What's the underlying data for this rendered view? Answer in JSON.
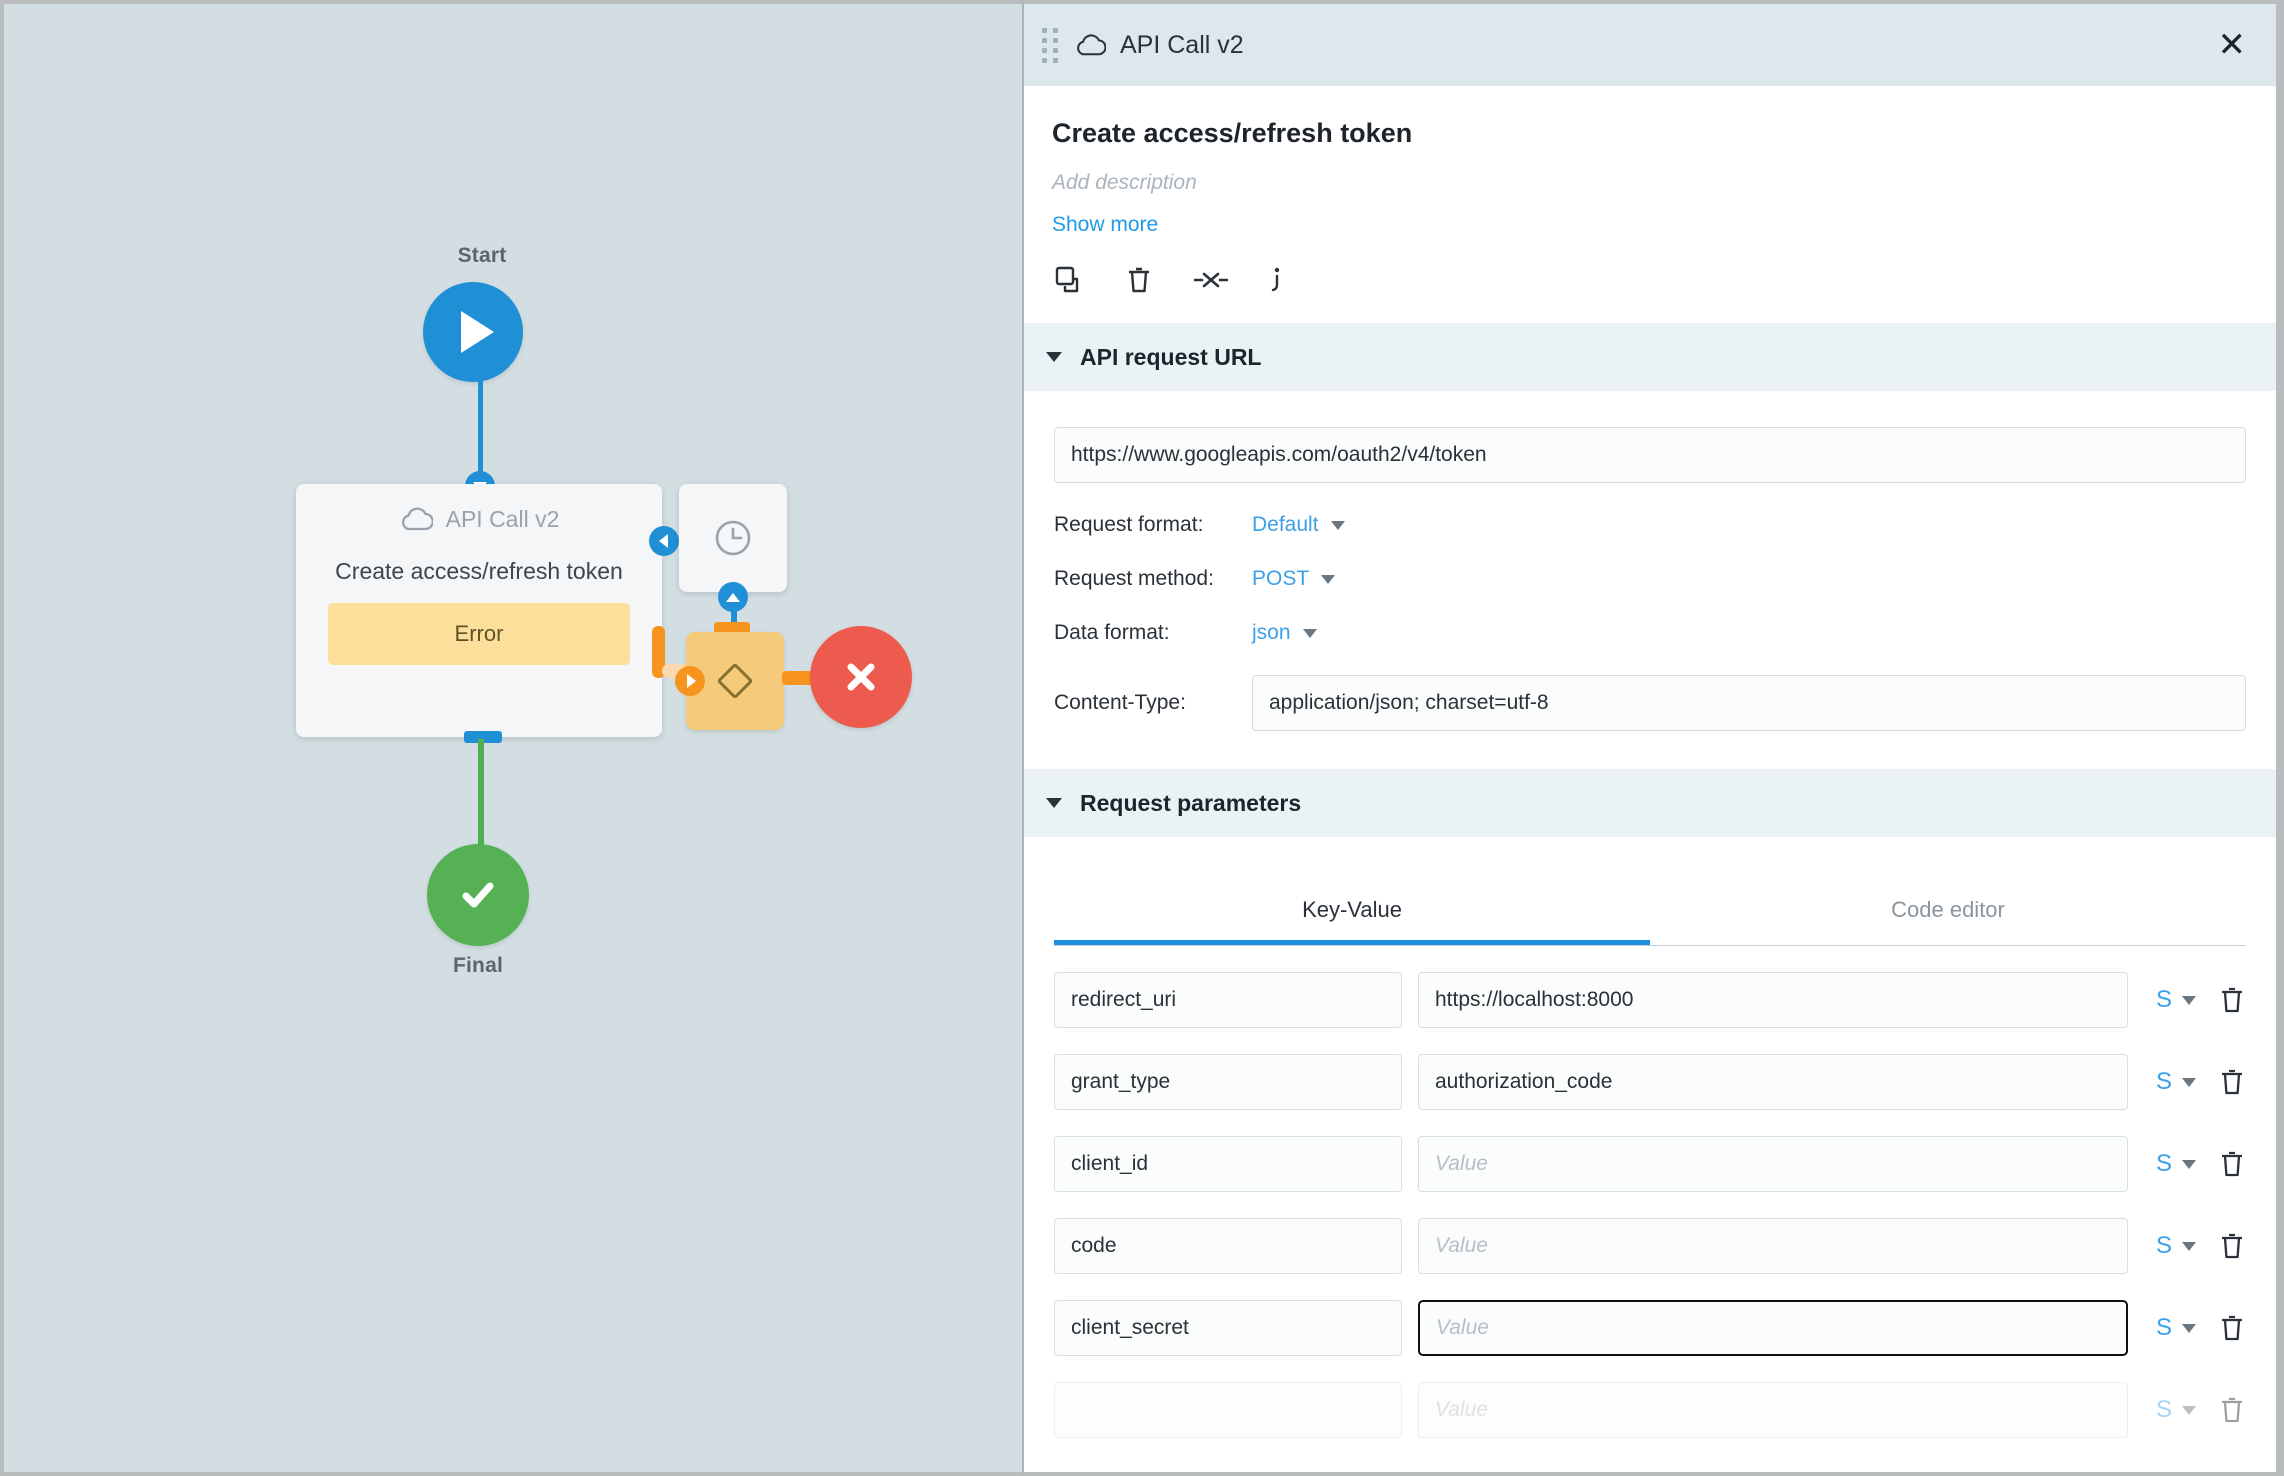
{
  "canvas": {
    "start_node": {
      "label": "Start",
      "icon": "play-icon",
      "color": "#1f8fd6"
    },
    "api_node": {
      "icon": "cloud-icon",
      "title": "API Call v2",
      "subtitle": "Create access/refresh token",
      "branch_label": "Error"
    },
    "timer_node": {
      "icon": "clock-icon"
    },
    "diamond_node": {
      "icon": "diamond-icon",
      "color": "#f5cb7b"
    },
    "error_end_node": {
      "icon": "close-x-icon",
      "color": "#ec5b4d"
    },
    "final_node": {
      "label": "Final",
      "icon": "check-icon",
      "color": "#56b155"
    }
  },
  "panel": {
    "header": {
      "icon": "cloud-icon",
      "title": "API Call v2",
      "close": "✕"
    },
    "block": {
      "title": "Create access/refresh token",
      "description_placeholder": "Add description",
      "show_more": "Show more",
      "actions": [
        {
          "name": "duplicate-icon",
          "title": "Duplicate"
        },
        {
          "name": "delete-icon",
          "title": "Delete"
        },
        {
          "name": "disconnect-icon",
          "title": "Disconnect"
        },
        {
          "name": "info-icon",
          "title": "Info"
        }
      ]
    },
    "url_section": {
      "title": "API request URL",
      "url": "https://www.googleapis.com/oauth2/v4/token",
      "fields": [
        {
          "label": "Request format:",
          "value": "Default",
          "type": "dropdown"
        },
        {
          "label": "Request method:",
          "value": "POST",
          "type": "dropdown"
        },
        {
          "label": "Data format:",
          "value": "json",
          "type": "dropdown"
        }
      ],
      "content_type_label": "Content-Type:",
      "content_type_value": "application/json; charset=utf-8"
    },
    "params_section": {
      "title": "Request parameters",
      "tabs": [
        {
          "label": "Key-Value",
          "active": true
        },
        {
          "label": "Code editor",
          "active": false
        }
      ],
      "value_placeholder": "Value",
      "type_symbol": "S",
      "rows": [
        {
          "key": "redirect_uri",
          "value": "https://localhost:8000",
          "type": "S",
          "focused": false
        },
        {
          "key": "grant_type",
          "value": "authorization_code",
          "type": "S",
          "focused": false
        },
        {
          "key": "client_id",
          "value": "",
          "type": "S",
          "focused": false
        },
        {
          "key": "code",
          "value": "",
          "type": "S",
          "focused": false
        },
        {
          "key": "client_secret",
          "value": "",
          "type": "S",
          "focused": true
        }
      ]
    }
  },
  "colors": {
    "accent_blue": "#1e9ae8",
    "canvas_bg": "#d2dee2",
    "panel_section_bg": "#eaf2f5",
    "warning": "#fcdf9b",
    "error_red": "#ec5b4d",
    "success_green": "#56b155"
  }
}
